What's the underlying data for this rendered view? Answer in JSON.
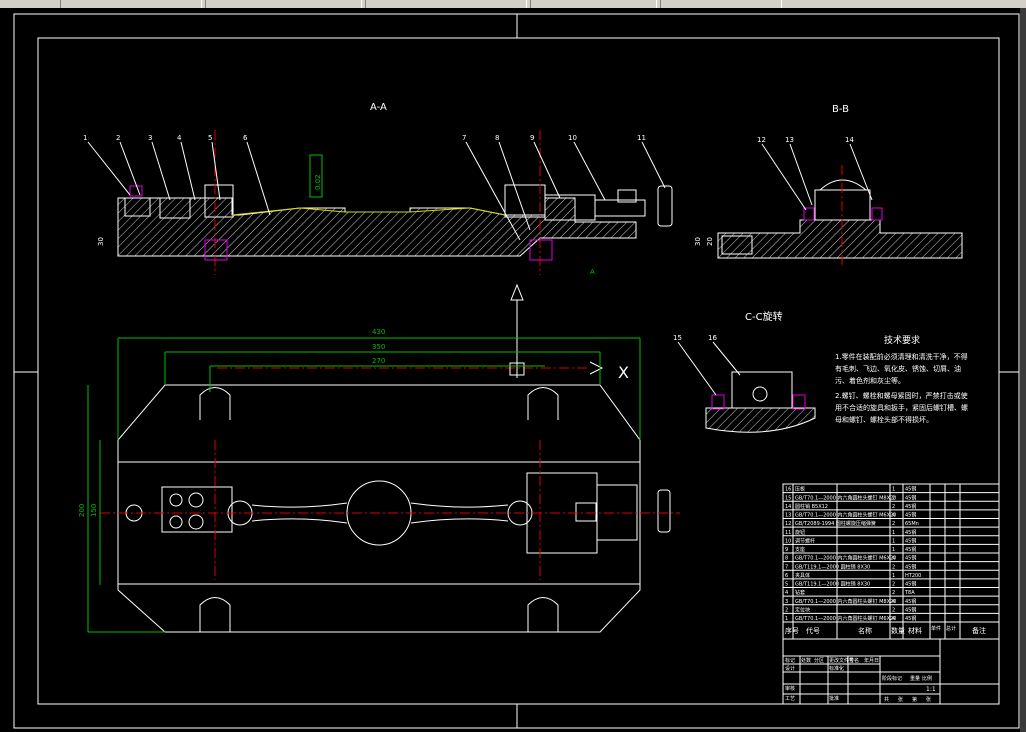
{
  "views": {
    "section_aa": "A-A",
    "section_bb": "B-B",
    "section_cc": "C-C旋转"
  },
  "balloons_aa": [
    "1",
    "2",
    "3",
    "4",
    "5",
    "6",
    "7",
    "8",
    "9",
    "10",
    "11"
  ],
  "balloons_bb": [
    "12",
    "13",
    "14"
  ],
  "balloons_cc": [
    "15",
    "16"
  ],
  "dims": {
    "d430": "430",
    "d350": "350",
    "d270": "270",
    "d200": "200",
    "d150": "150",
    "d30": "30",
    "d20": "20",
    "flatness": "0.02",
    "datum": "A",
    "x_axis": "X"
  },
  "tech": {
    "title": "技术要求",
    "lines": [
      "1.零件在装配前必须清理和清洗干净，不得",
      "有毛刺、飞边、氧化皮、锈蚀、切屑、油",
      "污、着色剂和灰尘等。",
      "2.螺钉、螺栓和螺母紧固时，严禁打击或使",
      "用不合适的旋具和扳手，紧固后螺钉槽、螺",
      "母和螺钉、螺栓头部不得损坏。"
    ]
  },
  "bom_rows": [
    "16|压板|1|45钢",
    "15|GB/T70.1—2000 内六角圆柱头螺钉 M8X20|2|45钢",
    "14|圆柱销 B5X12|2|45钢",
    "13|GB/T70.1—2000 内六角圆柱头螺钉 M6X20|4|45钢",
    "12|GB/T2089-1994 圆柱螺旋压缩弹簧|2|65Mn",
    "11|旋钮|1|45钢",
    "10|调节螺杆|1|45钢",
    "9|支座|1|45钢",
    "8|GB/T70.1—2000 内六角圆柱头螺钉 M6X20|4|45钢",
    "7|GB/T119.1—2000 圆柱销 8X30|2|45钢",
    "6|夹具体|1|HT200",
    "5|GB/T119.1—2000 圆柱销 8X30|2|45钢",
    "4|钻套|2|T8A",
    "3|GB/T70.1—2000 内六角圆柱头螺钉 M8X20|4|45钢",
    "2|定位块|2|45钢",
    "1|GB/T70.1—2000 内六角圆柱头螺钉 M6X20|4|45钢"
  ],
  "bom_header": [
    "序号",
    "代号",
    "名称",
    "数量",
    "材料",
    "单件",
    "总计",
    "备注"
  ],
  "title_block": {
    "row1": [
      "标记",
      "处数",
      "分区",
      "更改文件号",
      "签名",
      "年月日"
    ],
    "row2": [
      "设计",
      "",
      "",
      "标准化",
      "",
      ""
    ],
    "row3": [
      "审核",
      "",
      "",
      "",
      "",
      ""
    ],
    "row4": [
      "工艺",
      "",
      "",
      "批准",
      "",
      ""
    ],
    "stage": [
      "阶段标记",
      "重量",
      "比例"
    ],
    "scale": "1:1",
    "sheet": [
      "共",
      "张",
      "第",
      "张"
    ]
  },
  "colors": {
    "bg": "#000000",
    "line": "#ffffff",
    "dimension": "#00c000",
    "center": "#e00000",
    "hidden": "#d8d800",
    "fit": "#e000e0"
  }
}
